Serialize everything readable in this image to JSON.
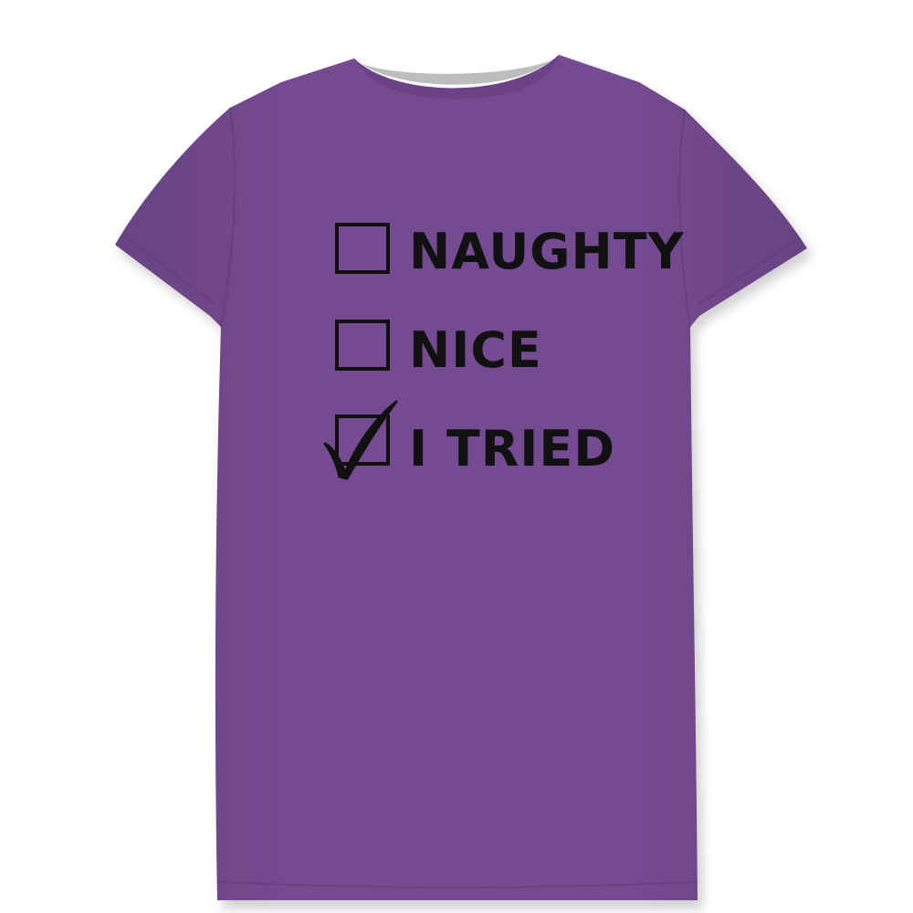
{
  "product": {
    "shirt_color": "#744a90",
    "collar_color": "#bdbdbd",
    "print_color": "#111111"
  },
  "print": {
    "options": [
      {
        "label": "Naughty",
        "checked": false
      },
      {
        "label": "Nice",
        "checked": false
      },
      {
        "label": "I Tried",
        "checked": true
      }
    ]
  }
}
